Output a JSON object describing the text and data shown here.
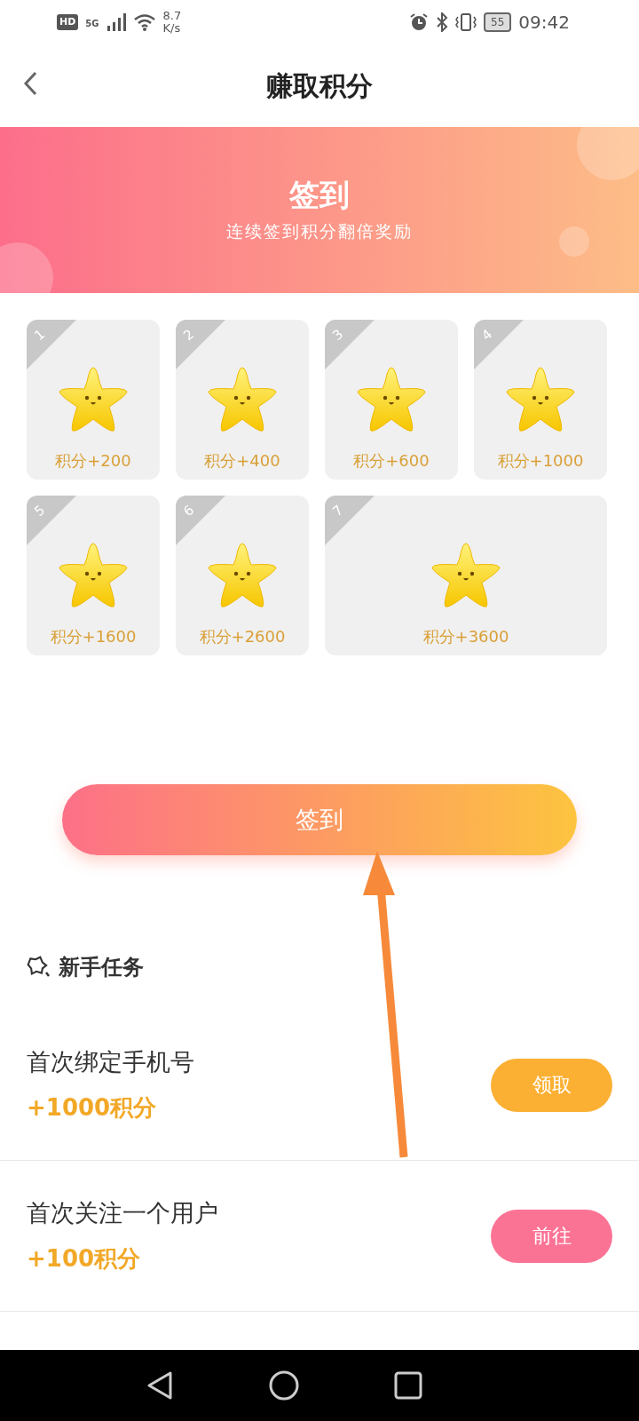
{
  "status_bar": {
    "hd": "HD",
    "network": "5G",
    "speed_value": "8.7",
    "speed_unit": "K/s",
    "battery": "55",
    "time": "09:42"
  },
  "header": {
    "title": "赚取积分"
  },
  "banner": {
    "title": "签到",
    "subtitle": "连续签到积分翻倍奖励"
  },
  "days": [
    {
      "number": "1",
      "reward": "积分+200"
    },
    {
      "number": "2",
      "reward": "积分+400"
    },
    {
      "number": "3",
      "reward": "积分+600"
    },
    {
      "number": "4",
      "reward": "积分+1000"
    },
    {
      "number": "5",
      "reward": "积分+1600"
    },
    {
      "number": "6",
      "reward": "积分+2600"
    },
    {
      "number": "7",
      "reward": "积分+3600"
    }
  ],
  "checkin_button": "签到",
  "section": {
    "title": "新手任务"
  },
  "tasks": [
    {
      "name": "首次绑定手机号",
      "points": "+1000积分",
      "button": "领取",
      "kind": "claim"
    },
    {
      "name": "首次关注一个用户",
      "points": "+100积分",
      "button": "前往",
      "kind": "go"
    }
  ]
}
